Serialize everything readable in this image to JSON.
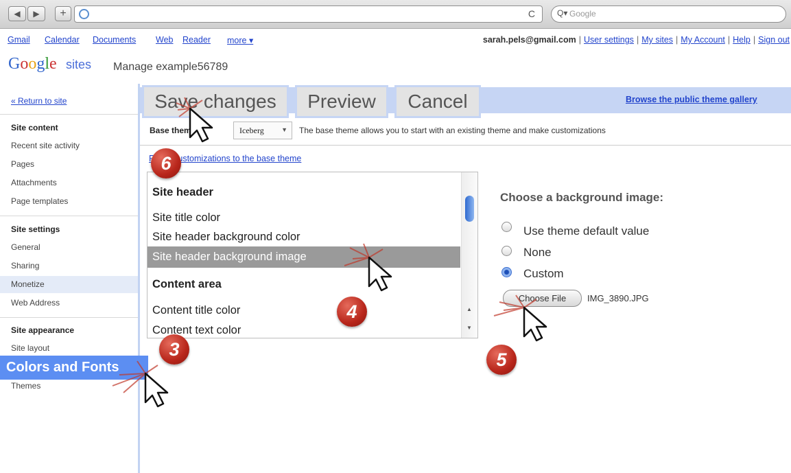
{
  "browser": {
    "back_glyph": "◀",
    "forward_glyph": "▶",
    "add_glyph": "+",
    "reload_glyph": "C",
    "search_placeholder": "Google"
  },
  "gbar": {
    "links": [
      "Gmail",
      "Calendar",
      "Documents",
      "Web",
      "Reader",
      "more ▾"
    ],
    "email": "sarah.pels@gmail.com",
    "account_links": [
      "User settings",
      "My sites",
      "My Account",
      "Help",
      "Sign out"
    ]
  },
  "header": {
    "logo": "Google",
    "product": "sites",
    "title": "Manage example56789"
  },
  "sidebar": {
    "return_link": "« Return to site",
    "site_content_heading": "Site content",
    "site_content_items": [
      "Recent site activity",
      "Pages",
      "Attachments",
      "Page templates"
    ],
    "site_settings_heading": "Site settings",
    "site_settings_items": [
      "General",
      "Sharing",
      "Monetize",
      "Web Address"
    ],
    "site_appearance_heading": "Site appearance",
    "site_appearance_items": [
      "Site layout",
      "Colors and Fonts",
      "Themes"
    ]
  },
  "toolbar": {
    "save_label": "Save changes",
    "preview_label": "Preview",
    "cancel_label": "Cancel",
    "gallery_link": "Browse the public theme gallery"
  },
  "theme": {
    "base_label": "Base theme",
    "selected": "Iceberg",
    "description": "The base theme allows you to start with an existing theme and make customizations",
    "reset_link": "Reset customizations to the base theme"
  },
  "options": {
    "site_header_heading": "Site header",
    "site_title_color": "Site title color",
    "site_header_bg_color": "Site header background color",
    "site_header_bg_image": "Site header background image",
    "content_area_heading": "Content area",
    "content_title_color": "Content title color",
    "content_text_color": "Content text color"
  },
  "background_image": {
    "title": "Choose a background image:",
    "options": [
      "Use theme default value",
      "None",
      "Custom"
    ],
    "selected": "Custom",
    "choose_file_label": "Choose File",
    "file_name": "IMG_3890.JPG"
  },
  "steps": [
    "3",
    "4",
    "5",
    "6"
  ],
  "colors": {
    "accent": "#5c8ef2",
    "band": "#c6d5f4",
    "link": "#2244cc",
    "badge": "#b8261b"
  }
}
